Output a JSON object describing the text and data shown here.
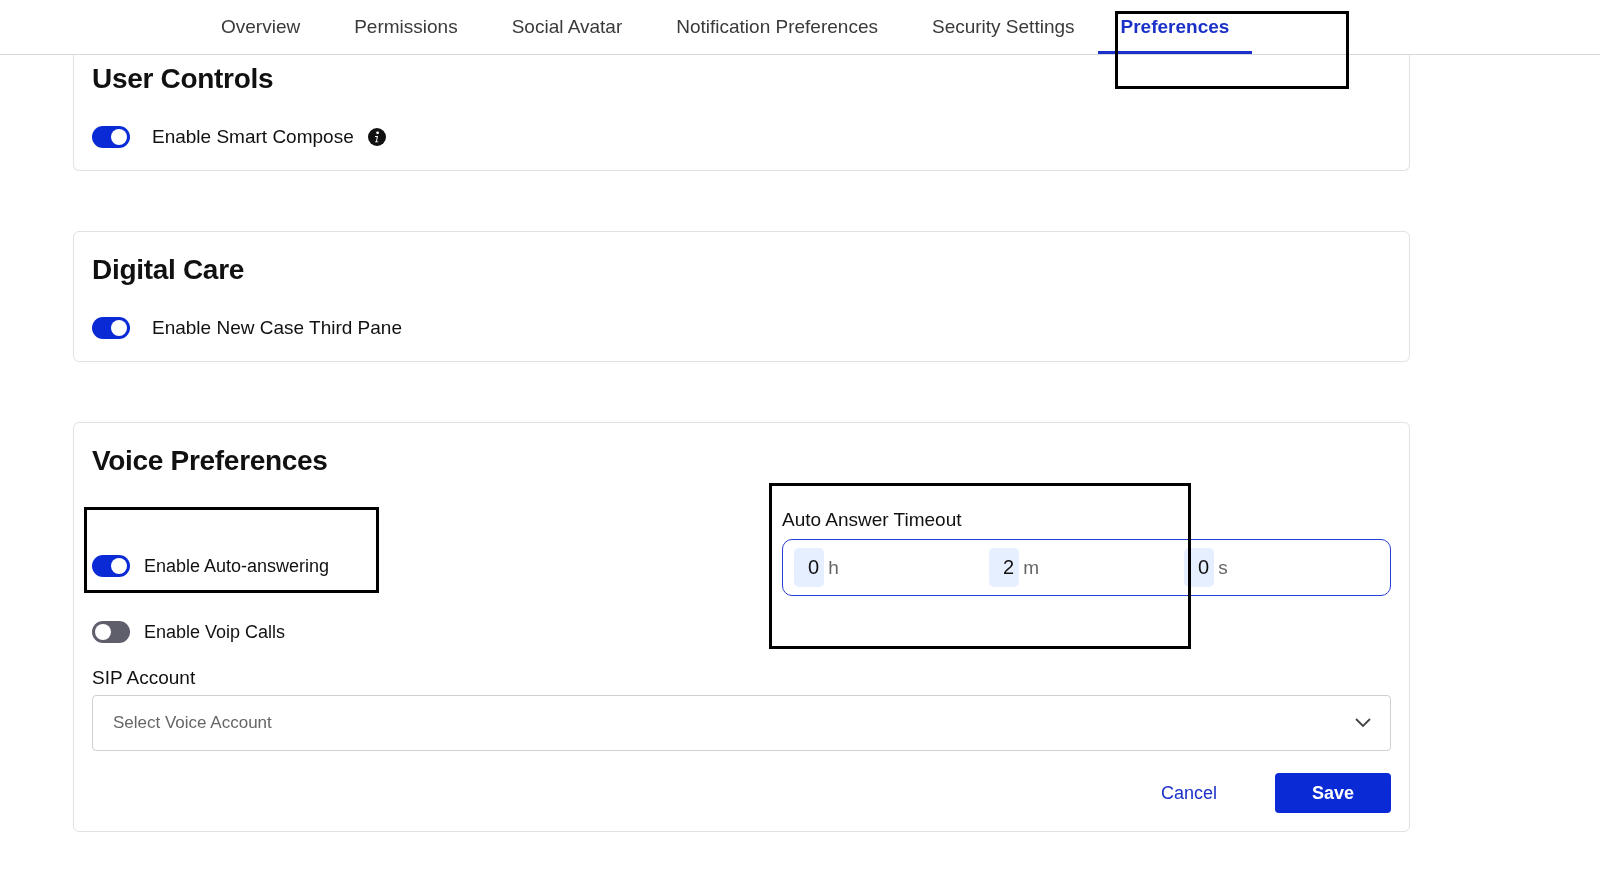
{
  "tabs": [
    {
      "label": "Overview",
      "selected": false
    },
    {
      "label": "Permissions",
      "selected": false
    },
    {
      "label": "Social Avatar",
      "selected": false
    },
    {
      "label": "Notification Preferences",
      "selected": false
    },
    {
      "label": "Security Settings",
      "selected": false
    },
    {
      "label": "Preferences",
      "selected": true
    }
  ],
  "user_controls": {
    "title": "User Controls",
    "toggles": [
      {
        "kind": "toggle_with_info",
        "label": "Enable Smart Compose",
        "on": true
      }
    ]
  },
  "digital_care": {
    "title": "Digital Care",
    "toggles": [
      {
        "kind": "toggle",
        "label": "Enable New Case Third Pane",
        "on": true
      }
    ]
  },
  "voice_preferences": {
    "title": "Voice Preferences",
    "toggles": [
      {
        "kind": "toggle",
        "label": "Enable Auto-answering",
        "on": true
      },
      {
        "kind": "toggle",
        "label": "Enable Voip Calls",
        "on": false
      }
    ],
    "auto_answer_timeout": {
      "label": "Auto Answer Timeout",
      "parts": [
        {
          "value": "0",
          "unit": "h"
        },
        {
          "value": "2",
          "unit": "m"
        },
        {
          "value": "0",
          "unit": "s"
        }
      ]
    },
    "sip_account": {
      "label": "SIP Account",
      "placeholder": "Select Voice Account"
    },
    "buttons": {
      "cancel": "Cancel",
      "save": "Save"
    }
  }
}
